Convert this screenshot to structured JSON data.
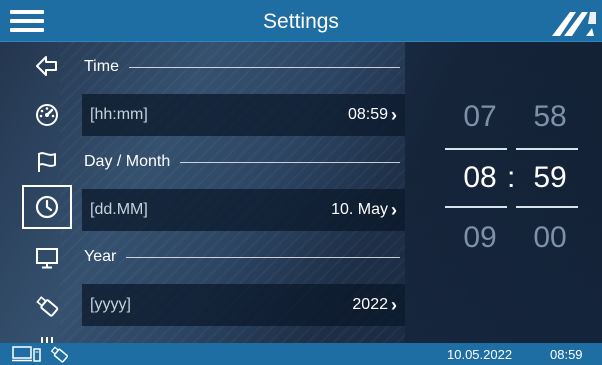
{
  "header": {
    "title": "Settings",
    "menu_icon": "hamburger-menu-icon",
    "logo_icon": "brand-logo-icon"
  },
  "sidebar": {
    "items": [
      {
        "icon": "arrow-left-icon",
        "active": false
      },
      {
        "icon": "speedometer-icon",
        "active": false
      },
      {
        "icon": "flag-icon",
        "active": false
      },
      {
        "icon": "clock-icon",
        "active": true
      },
      {
        "icon": "monitor-icon",
        "active": false
      },
      {
        "icon": "usb-stick-icon",
        "active": false
      },
      {
        "icon": "more-icon",
        "active": false
      }
    ]
  },
  "settings": {
    "time": {
      "heading": "Time",
      "placeholder": "[hh:mm]",
      "value": "08:59"
    },
    "daymonth": {
      "heading": "Day / Month",
      "placeholder": "[dd.MM]",
      "value": "10. May"
    },
    "year": {
      "heading": "Year",
      "placeholder": "[yyyy]",
      "value": "2022"
    }
  },
  "picker": {
    "hours": {
      "prev": "07",
      "current": "08",
      "next": "09"
    },
    "minutes": {
      "prev": "58",
      "current": "59",
      "next": "00"
    },
    "separator": ":"
  },
  "status": {
    "date": "10.05.2022",
    "time": "08:59"
  },
  "colors": {
    "bar": "#1f6ea3",
    "field": "#0a1628",
    "text": "#ffffff",
    "dim": "#7d91a8"
  }
}
